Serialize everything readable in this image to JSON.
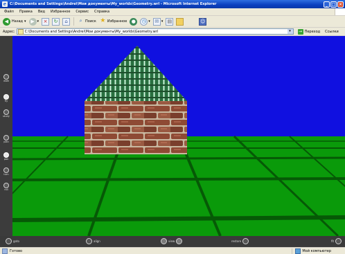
{
  "window": {
    "title": "C:\\Documents and Settings\\Andrei\\Мои документы\\My_worlds\\Geometry.wrl - Microsoft Internet Explorer"
  },
  "menu": {
    "items": [
      "Файл",
      "Правка",
      "Вид",
      "Избранное",
      "Сервис",
      "Справка"
    ]
  },
  "toolbar": {
    "back_label": "Назад",
    "search_label": "Поиск",
    "favorites_label": "Избранное"
  },
  "address": {
    "label": "Адрес:",
    "value": "C:\\Documents and Settings\\Andrei\\Мои документы\\My_worlds\\Geometry.wrl",
    "go_label": "Переход",
    "links_label": "Ссылки"
  },
  "sidebar": {
    "items": [
      "walk",
      "fly",
      "study",
      "plan",
      "pan",
      "turn",
      "roll"
    ]
  },
  "bottombar": {
    "goto_label": "goto",
    "align_label": "align",
    "view_label": "view",
    "restore_label": "restore",
    "fit_label": "fit"
  },
  "status": {
    "left_text": "Готово",
    "zone_text": "Мой компьютер"
  },
  "colors": {
    "sky": "#1010e0",
    "ground": "#0a9a0a",
    "roof": "#2f7d48",
    "brick": "#8a4a34"
  }
}
